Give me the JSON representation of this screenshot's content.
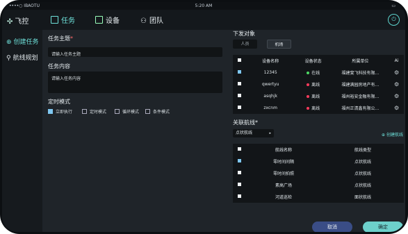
{
  "status": {
    "carrier": "••••○ IBAOTU",
    "time": "5:20 AM"
  },
  "brand": {
    "name": "飞控"
  },
  "nav": {
    "tabs": [
      {
        "label": "任务"
      },
      {
        "label": "设备"
      },
      {
        "label": "团队"
      }
    ]
  },
  "sidebar": {
    "items": [
      {
        "label": "创建任务"
      },
      {
        "label": "航线规划"
      }
    ]
  },
  "form": {
    "subject_label": "任务主题",
    "subject_placeholder": "请输入任务主题",
    "content_label": "任务内容",
    "content_placeholder": "请输入任务内容",
    "timing_label": "定时模式",
    "timing_options": [
      {
        "label": "立即执行",
        "checked": true
      },
      {
        "label": "定时模式",
        "checked": false
      },
      {
        "label": "循环模式",
        "checked": false
      },
      {
        "label": "条件模式",
        "checked": false
      }
    ]
  },
  "dispatch": {
    "label": "下发对象",
    "segments": [
      {
        "label": "人员"
      },
      {
        "label": "机场",
        "selected": true
      }
    ],
    "headers": [
      "设备名称",
      "设备状态",
      "所属单位",
      "Ai"
    ],
    "rows": [
      {
        "name": "12345",
        "status": "在线",
        "status_color": "#4cd964",
        "unit": "福建斐飞科技有限...",
        "checked": true
      },
      {
        "name": "qwertyu",
        "status": "离线",
        "status_color": "#ff3b5c",
        "unit": "福建满园房地产有...",
        "checked": false
      },
      {
        "name": "asqhjk",
        "status": "离线",
        "status_color": "#ff3b5c",
        "unit": "福州裕安金融有限...",
        "checked": false
      },
      {
        "name": "zxcnm",
        "status": "离线",
        "status_color": "#ff3b5c",
        "unit": "福州正清鑫有限公...",
        "checked": false
      }
    ]
  },
  "route": {
    "label": "关联航线",
    "dropdown_value": "点状航线",
    "create_label": "创建航线",
    "headers": [
      "航线名称",
      "航线类型"
    ],
    "rows": [
      {
        "name": "零时间间隔",
        "type": "点状航线",
        "checked": true
      },
      {
        "name": "零时间拍照",
        "type": "点状航线",
        "checked": false
      },
      {
        "name": "素高广场",
        "type": "点状航线",
        "checked": false
      },
      {
        "name": "河道巡检",
        "type": "面状航线",
        "checked": false
      }
    ]
  },
  "actions": {
    "cancel": "取消",
    "confirm": "确定"
  },
  "colors": {
    "accent": "#6fe3dc",
    "cancel": "#3a4d86",
    "confirm": "#6dd0cb",
    "online": "#4cd964",
    "offline": "#ff3b5c"
  }
}
